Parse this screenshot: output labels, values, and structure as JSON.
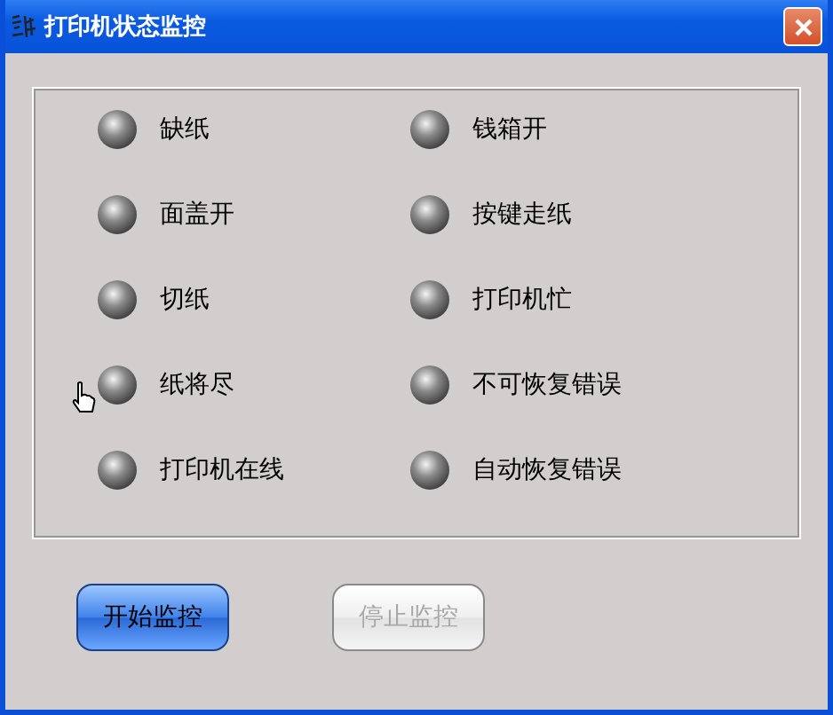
{
  "window": {
    "title": "打印机状态监控"
  },
  "indicators": [
    {
      "label": "缺纸",
      "on": false
    },
    {
      "label": "钱箱开",
      "on": false
    },
    {
      "label": "面盖开",
      "on": false
    },
    {
      "label": "按键走纸",
      "on": false
    },
    {
      "label": "切纸",
      "on": false
    },
    {
      "label": "打印机忙",
      "on": false
    },
    {
      "label": "纸将尽",
      "on": false
    },
    {
      "label": "不可恢复错误",
      "on": false
    },
    {
      "label": "打印机在线",
      "on": false
    },
    {
      "label": "自动恢复错误",
      "on": false
    }
  ],
  "buttons": [
    {
      "label": "开始监控",
      "disabled": false
    },
    {
      "label": "停止监控",
      "disabled": true
    }
  ]
}
